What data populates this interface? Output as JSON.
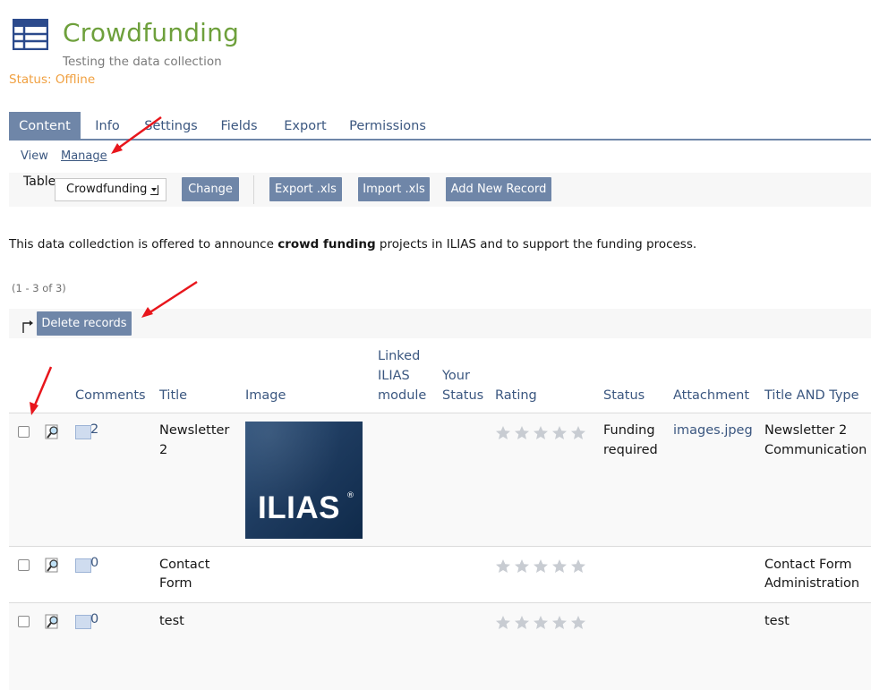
{
  "header": {
    "title": "Crowdfunding",
    "subtitle": "Testing the data collection",
    "status": "Status: Offline",
    "icon": "table-icon"
  },
  "tabs": [
    {
      "label": "Content",
      "active": true
    },
    {
      "label": "Info",
      "active": false
    },
    {
      "label": "Settings",
      "active": false
    },
    {
      "label": "Fields",
      "active": false
    },
    {
      "label": "Export",
      "active": false
    },
    {
      "label": "Permissions",
      "active": false
    }
  ],
  "subtabs": [
    {
      "label": "View",
      "active": false
    },
    {
      "label": "Manage",
      "active": true
    }
  ],
  "toolbar": {
    "table_label": "Table",
    "table_select_value": "Crowdfunding",
    "change_label": "Change",
    "export_label": "Export .xls",
    "import_label": "Import .xls",
    "add_label": "Add New Record"
  },
  "intro": {
    "before": "This data colledction is offered to announce ",
    "bold": "crowd funding",
    "after": " projects in ILIAS and to support the funding process."
  },
  "range_text": "(1 - 3 of 3)",
  "multi_action": {
    "delete_label": "Delete records"
  },
  "columns": {
    "comments": "Comments",
    "title": "Title",
    "image": "Image",
    "linked_1": "Linked",
    "linked_2": "ILIAS",
    "linked_3": "module",
    "your_status_1": "Your",
    "your_status_2": "Status",
    "rating": "Rating",
    "status": "Status",
    "attachment": "Attachment",
    "title_type": "Title AND Type"
  },
  "rows": [
    {
      "comments": "2",
      "title_1": "Newsletter",
      "title_2": "2",
      "image_text": "ILIAS",
      "image_reg": "®",
      "status_1": "Funding",
      "status_2": "required",
      "attachment": "images.jpeg",
      "title_type_1": "Newsletter 2",
      "title_type_2": "Communication",
      "rating": 0
    },
    {
      "comments": "0",
      "title_1": "Contact",
      "title_2": "Form",
      "status_1": "",
      "status_2": "",
      "attachment": "",
      "title_type_1": "Contact Form",
      "title_type_2": "Administration",
      "rating": 0
    },
    {
      "comments": "0",
      "title_1": "test",
      "title_2": "",
      "status_1": "",
      "status_2": "",
      "attachment": "",
      "title_type_1": "test",
      "title_type_2": "",
      "rating": 0
    }
  ],
  "colors": {
    "title_green": "#6ea03c",
    "status_orange": "#f0a040",
    "tab_blue": "#6f86a8",
    "link_blue": "#3b5780",
    "annotation_red": "#e8161c"
  },
  "icons": [
    "table-icon",
    "sub-arrow-icon",
    "view-magnifier-icon",
    "comment-icon",
    "star-icon"
  ]
}
